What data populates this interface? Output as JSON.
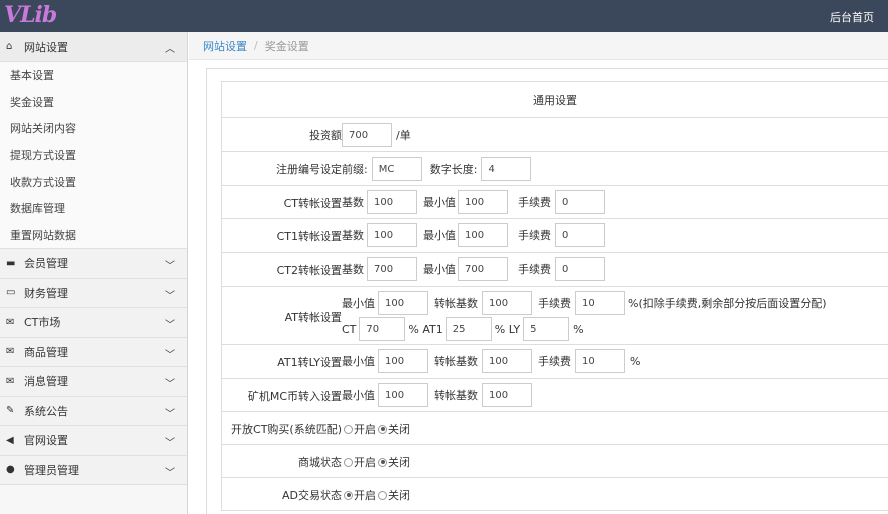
{
  "header": {
    "logo": "VLib",
    "home_link": "后台首页"
  },
  "sidebar": {
    "active_group": "网站设置",
    "sub_items": [
      "基本设置",
      "奖金设置",
      "网站关闭内容",
      "提现方式设置",
      "收款方式设置",
      "数据库管理",
      "重置网站数据"
    ],
    "groups": [
      "会员管理",
      "财务管理",
      "CT市场",
      "商品管理",
      "消息管理",
      "系统公告",
      "官网设置",
      "管理员管理"
    ]
  },
  "breadcrumb": {
    "parent": "网站设置",
    "sep": "/",
    "current": "奖金设置"
  },
  "form": {
    "section_title": "通用设置",
    "invest": {
      "label": "投资额",
      "value": "700",
      "unit": "/单"
    },
    "reg": {
      "label": "注册编号设定",
      "prefix_label": "前缀:",
      "prefix_value": "MC",
      "len_label": "数字长度:",
      "len_value": "4"
    },
    "ct": {
      "label": "CT转帐设置",
      "base_label": "基数",
      "base": "100",
      "min_label": "最小值",
      "min": "100",
      "fee_label": "手续费",
      "fee": "0"
    },
    "ct1": {
      "label": "CT1转帐设置",
      "base_label": "基数",
      "base": "100",
      "min_label": "最小值",
      "min": "100",
      "fee_label": "手续费",
      "fee": "0"
    },
    "ct2": {
      "label": "CT2转帐设置",
      "base_label": "基数",
      "base": "700",
      "min_label": "最小值",
      "min": "700",
      "fee_label": "手续费",
      "fee": "0"
    },
    "at": {
      "label": "AT转帐设置",
      "min_label": "最小值",
      "min": "100",
      "base_label": "转帐基数",
      "base": "100",
      "fee_label": "手续费",
      "fee": "10",
      "fee_note": "%(扣除手续费,剩余部分按后面设置分配)",
      "ct_label": "CT",
      "ct": "70",
      "at1_label": "% AT1",
      "at1": "25",
      "ly_label": "% LY",
      "ly": "5",
      "pct": "%"
    },
    "at1ly": {
      "label": "AT1转LY设置",
      "min_label": "最小值",
      "min": "100",
      "base_label": "转帐基数",
      "base": "100",
      "fee_label": "手续费",
      "fee": "10",
      "pct": "%"
    },
    "mc": {
      "label": "矿机MC币转入设置",
      "min_label": "最小值",
      "min": "100",
      "base_label": "转帐基数",
      "base": "100"
    },
    "ct_buy": {
      "label": "开放CT购买(系统匹配)",
      "on": "开启",
      "off": "关闭",
      "selected": "off"
    },
    "mall": {
      "label": "商城状态",
      "on": "开启",
      "off": "关闭",
      "selected": "off"
    },
    "ad": {
      "label": "AD交易状态",
      "on": "开启",
      "off": "关闭",
      "selected": "on"
    }
  }
}
